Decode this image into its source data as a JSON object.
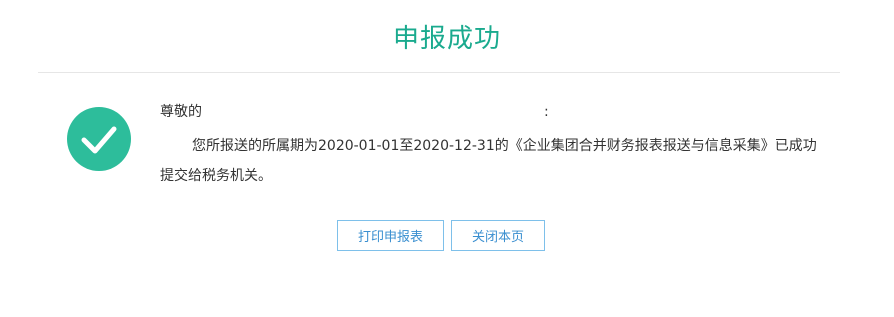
{
  "title": "申报成功",
  "greeting": "尊敬的",
  "greeting_colon": ":",
  "message": "您所报送的所属期为2020-01-01至2020-12-31的《企业集团合并财务报表报送与信息采集》已成功提交给税务机关。",
  "buttons": {
    "print_label": "打印申报表",
    "close_label": "关闭本页"
  },
  "icons": {
    "success": "check-circle-icon"
  },
  "colors": {
    "title": "#1aaa8e",
    "success_circle": "#2dbd9b",
    "button_border": "#7ec0ea",
    "button_text": "#3a8fd0"
  }
}
